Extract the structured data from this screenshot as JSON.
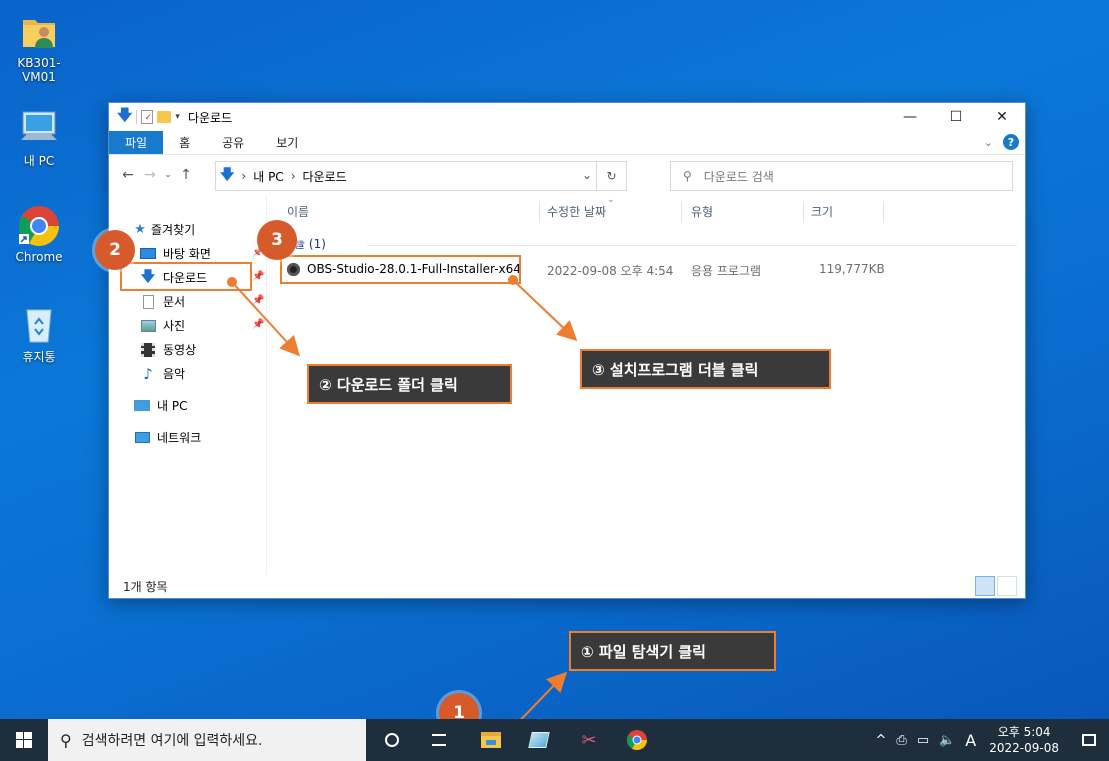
{
  "desktop": {
    "icons": [
      {
        "label": "KB301-VM01",
        "icon": "user-folder-icon"
      },
      {
        "label": "내 PC",
        "icon": "computer-icon"
      },
      {
        "label": "Chrome",
        "icon": "chrome-icon"
      },
      {
        "label": "휴지통",
        "icon": "recycle-bin-icon"
      }
    ]
  },
  "window": {
    "title": "다운로드",
    "controls": {
      "minimize": "—",
      "maximize": "☐",
      "close": "✕"
    },
    "ribbon_tabs": [
      "파일",
      "홈",
      "공유",
      "보기"
    ],
    "address": {
      "parts": [
        "내 PC",
        "다운로드"
      ]
    },
    "search_placeholder": "다운로드 검색",
    "nav": {
      "quick_access": "즐겨찾기",
      "items": [
        "바탕 화면",
        "다운로드",
        "문서",
        "사진",
        "동영상",
        "음악"
      ],
      "this_pc": "내 PC",
      "network": "네트워크"
    },
    "columns": [
      "이름",
      "수정한 날짜",
      "유형",
      "크기"
    ],
    "group_label": "오늘 (1)",
    "files": [
      {
        "name": "OBS-Studio-28.0.1-Full-Installer-x64",
        "date": "2022-09-08 오후 4:54",
        "type": "응용 프로그램",
        "size": "119,777KB"
      }
    ],
    "status": "1개 항목"
  },
  "annotations": {
    "badges": [
      "1",
      "2",
      "3"
    ],
    "callouts": {
      "step1": "① 파일 탐색기 클릭",
      "step2": "② 다운로드 폴더 클릭",
      "step3": "③ 설치프로그램 더블 클릭"
    },
    "accent_color": "#ed7d31",
    "badge_color": "#d75a2b"
  },
  "taskbar": {
    "search_placeholder": "검색하려면 여기에 입력하세요.",
    "ime": "A",
    "time": "오후 5:04",
    "date": "2022-09-08"
  }
}
